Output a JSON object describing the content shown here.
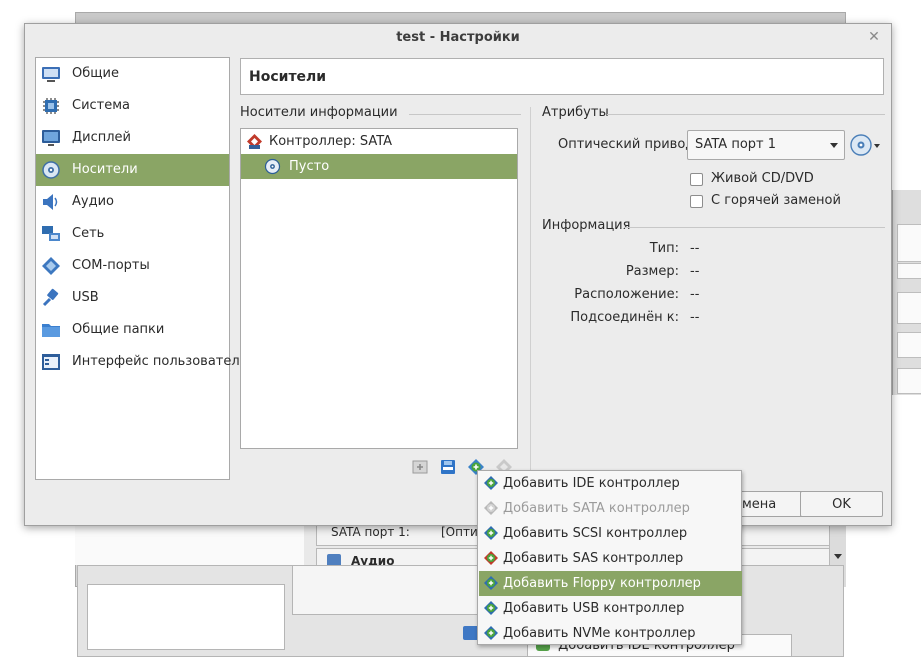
{
  "dialog": {
    "title": "test - Настройки",
    "close_icon": "close-icon",
    "page_title": "Носители",
    "ok_label": "OK",
    "cancel_label_partial": "мена"
  },
  "categories": [
    {
      "label": "Общие",
      "icon": "general-icon",
      "selected": false
    },
    {
      "label": "Система",
      "icon": "system-icon",
      "selected": false
    },
    {
      "label": "Дисплей",
      "icon": "display-icon",
      "selected": false
    },
    {
      "label": "Носители",
      "icon": "storage-icon",
      "selected": true
    },
    {
      "label": "Аудио",
      "icon": "audio-icon",
      "selected": false
    },
    {
      "label": "Сеть",
      "icon": "network-icon",
      "selected": false
    },
    {
      "label": "COM-порты",
      "icon": "serial-ports-icon",
      "selected": false
    },
    {
      "label": "USB",
      "icon": "usb-icon",
      "selected": false
    },
    {
      "label": "Общие папки",
      "icon": "shared-folders-icon",
      "selected": false
    },
    {
      "label": "Интерфейс пользователя",
      "icon": "user-interface-icon",
      "selected": false
    }
  ],
  "storage": {
    "group_label": "Носители информации",
    "tree": [
      {
        "label": "Контроллер: SATA",
        "type": "controller"
      },
      {
        "label": "Пусто",
        "type": "empty-optical",
        "selected": true
      }
    ],
    "toolbar_icons": [
      "add-attachment-icon",
      "remove-attachment-icon",
      "add-controller-icon",
      "remove-controller-icon"
    ]
  },
  "attributes": {
    "group_label": "Атрибуты",
    "optical_drive_label": "Оптический привод:",
    "optical_drive_value": "SATA порт 1",
    "live_cd_label": "Живой CD/DVD",
    "hot_plug_label": "С горячей заменой"
  },
  "information": {
    "group_label": "Информация",
    "rows": [
      {
        "label": "Тип:",
        "value": "--"
      },
      {
        "label": "Размер:",
        "value": "--"
      },
      {
        "label": "Расположение:",
        "value": "--"
      },
      {
        "label": "Подсоединён к:",
        "value": "--"
      }
    ]
  },
  "context_menu": {
    "items": [
      {
        "label": "Добавить IDE контроллер",
        "enabled": true,
        "highlighted": false
      },
      {
        "label": "Добавить SATA контроллер",
        "enabled": false,
        "highlighted": false
      },
      {
        "label": "Добавить SCSI контроллер",
        "enabled": true,
        "highlighted": false
      },
      {
        "label": "Добавить SAS контроллер",
        "enabled": true,
        "highlighted": false
      },
      {
        "label": "Добавить Floppy контроллер",
        "enabled": true,
        "highlighted": true
      },
      {
        "label": "Добавить USB контроллер",
        "enabled": true,
        "highlighted": false
      },
      {
        "label": "Добавить NVMe контроллер",
        "enabled": true,
        "highlighted": false
      }
    ]
  },
  "background": {
    "port_label": "SATA порт 1:",
    "port_value_partial": "[Опти",
    "audio_label": "Аудио",
    "menu_item": "Добавить IDE контроллер"
  },
  "colors": {
    "selection": "#8aa565",
    "dialog_bg": "#ececec"
  }
}
